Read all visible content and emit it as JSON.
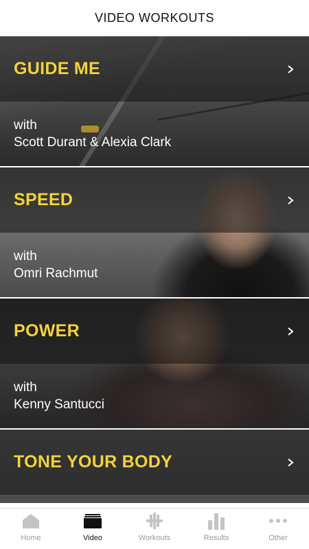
{
  "header": {
    "title": "VIDEO WORKOUTS"
  },
  "workouts": [
    {
      "title": "GUIDE ME",
      "with": "with",
      "trainer": "Scott Durant & Alexia Clark"
    },
    {
      "title": "SPEED",
      "with": "with",
      "trainer": "Omri Rachmut"
    },
    {
      "title": "POWER",
      "with": "with",
      "trainer": "Kenny Santucci"
    },
    {
      "title": "TONE YOUR BODY"
    }
  ],
  "tabbar": {
    "items": [
      {
        "label": "Home",
        "icon": "home-icon",
        "active": false
      },
      {
        "label": "Video",
        "icon": "video-icon",
        "active": true
      },
      {
        "label": "Workouts",
        "icon": "dumbbell-icon",
        "active": false
      },
      {
        "label": "Results",
        "icon": "bar-chart-icon",
        "active": false
      },
      {
        "label": "Other",
        "icon": "more-icon",
        "active": false
      }
    ]
  },
  "colors": {
    "accent": "#f4d33a",
    "inactive": "#9a9a9a",
    "active": "#111111"
  }
}
